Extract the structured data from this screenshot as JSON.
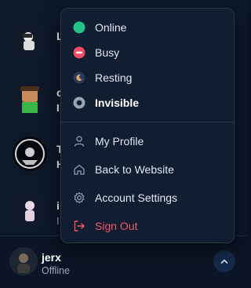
{
  "friends": [
    {
      "name": "L",
      "sub": ""
    },
    {
      "name": "c",
      "sub": "I"
    },
    {
      "name": "T",
      "sub": "H"
    },
    {
      "name": "i",
      "sub": "I"
    }
  ],
  "status_menu": {
    "items": [
      {
        "label": "Online",
        "color": "#22c48a"
      },
      {
        "label": "Busy",
        "color": "#ef4d63"
      },
      {
        "label": "Resting",
        "color": "#6b7fa8"
      },
      {
        "label": "Invisible",
        "color": "#9aa3b2"
      }
    ]
  },
  "account_menu": {
    "items": [
      {
        "label": "My Profile",
        "icon": "user-icon"
      },
      {
        "label": "Back to Website",
        "icon": "home-icon"
      },
      {
        "label": "Account Settings",
        "icon": "gear-icon"
      },
      {
        "label": "Sign Out",
        "icon": "sign-out-icon",
        "color": "#f0566b"
      }
    ]
  },
  "user": {
    "name": "jerx",
    "status": "Offline"
  },
  "colors": {
    "background": "#0b1525",
    "menu_bg": "#111d30",
    "accent": "#142a4a"
  }
}
